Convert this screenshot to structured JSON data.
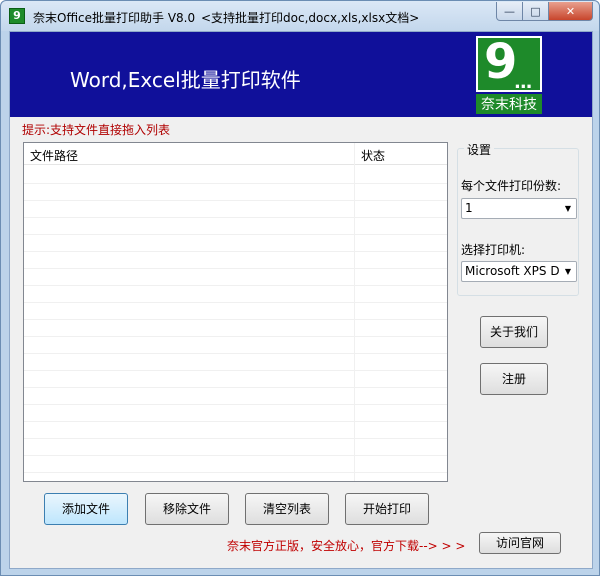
{
  "window": {
    "title": "奈末Office批量打印助手 V8.0",
    "subtitle": "<支持批量打印doc,docx,xls,xlsx文档>",
    "app_icon_glyph": "9"
  },
  "banner": {
    "title": "Word,Excel批量打印软件",
    "logo_glyph": "9",
    "logo_dots": "...",
    "logo_text": "奈末科技",
    "bg_color": "#10109a",
    "logo_color": "#1e8a2a"
  },
  "hint": "提示:支持文件直接拖入列表",
  "file_list": {
    "columns": [
      "文件路径",
      "状态"
    ],
    "rows": []
  },
  "settings": {
    "group_title": "设置",
    "copies_label": "每个文件打印份数:",
    "copies_value": "1",
    "printer_label": "选择打印机:",
    "printer_value": "Microsoft XPS Doc"
  },
  "buttons": {
    "about": "关于我们",
    "register": "注册",
    "add_file": "添加文件",
    "remove_file": "移除文件",
    "clear_list": "清空列表",
    "start_print": "开始打印",
    "visit_site": "访问官网"
  },
  "promo": "奈末官方正版，安全放心，官方下载--> > >"
}
